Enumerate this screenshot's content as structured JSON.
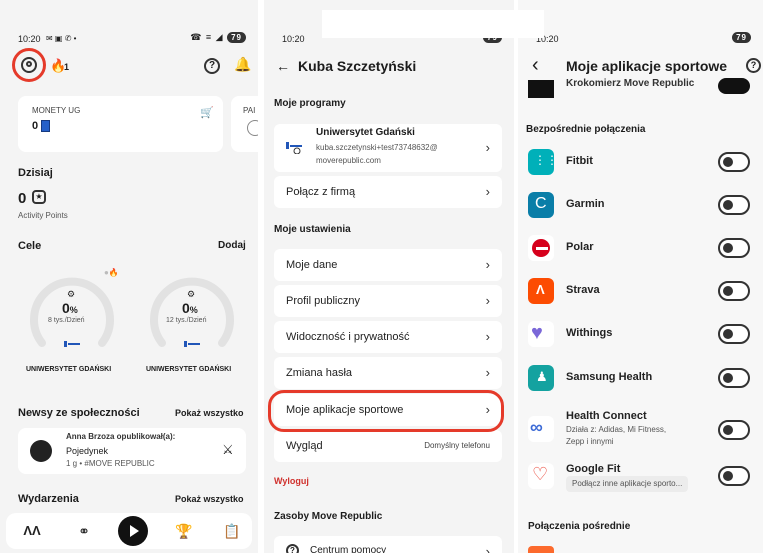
{
  "panel1": {
    "status": {
      "time": "10:20",
      "icons": "✉ ▣ ✆ •",
      "signal": "☎ ≡ ◢",
      "battery": "79"
    },
    "avatar_badge": "1",
    "coins": {
      "label": "MONETY UG",
      "value": "0",
      "cart_icon": "cart-icon",
      "partial_label": "PAI"
    },
    "today": {
      "title": "Dzisiaj",
      "points": "0",
      "points_label": "Activity Points"
    },
    "goals": {
      "title": "Cele",
      "add_label": "Dodaj",
      "items": [
        {
          "value": "0%",
          "value_num": "0",
          "unit": "%",
          "target": "8 tys./Dzień",
          "org": "UNIWERSYTET GDAŃSKI"
        },
        {
          "value": "0%",
          "value_num": "0",
          "unit": "%",
          "target": "12 tys./Dzień",
          "org": "UNIWERSYTET GDAŃSKI"
        }
      ]
    },
    "news": {
      "title": "Newsy ze społeczności",
      "show_all": "Pokaż wszystko",
      "post_author": "Anna Brzoza opublikował(a):",
      "post_title": "Pojedynek",
      "post_meta": "1 g • #MOVE REPUBLIC"
    },
    "events": {
      "title": "Wydarzenia",
      "show_all": "Pokaż wszystko"
    },
    "nav": [
      "home-logo",
      "people-icon",
      "play-icon",
      "trophy-icon",
      "clipboard-icon"
    ]
  },
  "panel2": {
    "status": {
      "time": "10:20",
      "battery": "79"
    },
    "back": "←",
    "title": "Kuba Szczetyński",
    "programs_title": "Moje programy",
    "program": {
      "name": "Uniwersytet Gdański",
      "email": "kuba.szczetynski+test73748632@",
      "email2": "moverepublic.com"
    },
    "connect_company": "Połącz z firmą",
    "settings_title": "Moje ustawienia",
    "settings": [
      "Moje dane",
      "Profil publiczny",
      "Widoczność i prywatność",
      "Zmiana hasła",
      "Moje aplikacje sportowe"
    ],
    "appearance": {
      "label": "Wygląd",
      "value": "Domyślny telefonu"
    },
    "logout": "Wyloguj",
    "resources_title": "Zasoby Move Republic",
    "help": "Centrum pomocy",
    "chevron": "›"
  },
  "panel3": {
    "status": {
      "time": "10:20",
      "battery": "79"
    },
    "back": "‹",
    "title": "Moje aplikacje sportowe",
    "help_icon": "help-icon",
    "partial_item": "Krokomierz Move Republic",
    "direct_title": "Bezpośrednie połączenia",
    "apps": [
      {
        "name": "Fitbit",
        "color": "#00b0b9"
      },
      {
        "name": "Garmin",
        "color": "#0a7ea8"
      },
      {
        "name": "Polar",
        "color": "#d6001c"
      },
      {
        "name": "Strava",
        "color": "#fc4c02"
      },
      {
        "name": "Withings",
        "color": "#7a67d8"
      },
      {
        "name": "Samsung Health",
        "color": "#14a2a0"
      },
      {
        "name": "Health Connect",
        "color": "#3d6bd6",
        "sub1": "Działa z: Adidas, Mi Fitness,",
        "sub2": "Zepp i innymi"
      },
      {
        "name": "Google Fit",
        "color": "#ea4335",
        "chip": "Podłącz inne aplikacje sporto..."
      }
    ],
    "indirect_title": "Połączenia pośrednie"
  }
}
